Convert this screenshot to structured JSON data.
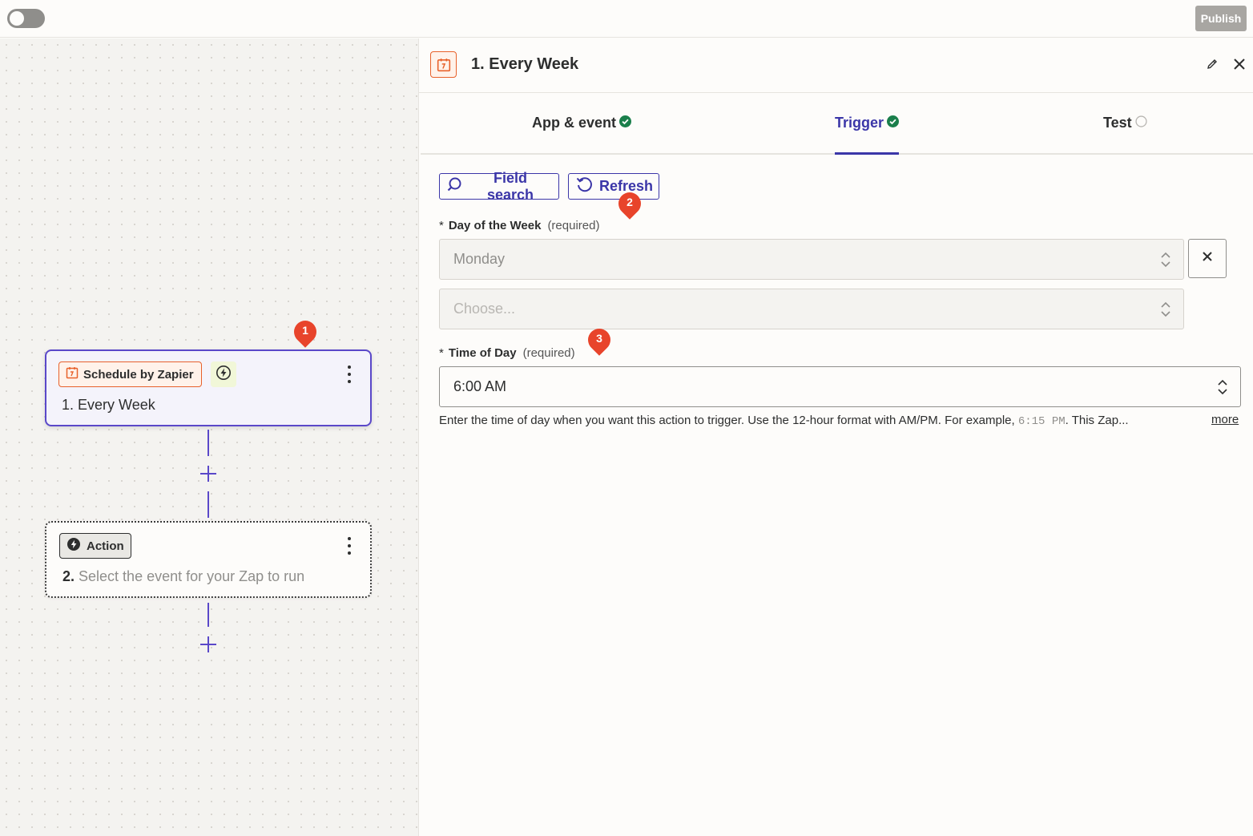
{
  "topbar": {
    "publish_label": "Publish"
  },
  "canvas": {
    "trigger_step": {
      "app_name": "Schedule by Zapier",
      "number": "1.",
      "title": "Every Week"
    },
    "action_step": {
      "chip_label": "Action",
      "number": "2.",
      "title": "Select the event for your Zap to run"
    },
    "markers": [
      "1",
      "2",
      "3"
    ]
  },
  "panel": {
    "title": "1. Every Week",
    "tabs": [
      {
        "label": "App & event",
        "status": "complete"
      },
      {
        "label": "Trigger",
        "status": "complete"
      },
      {
        "label": "Test",
        "status": "incomplete"
      }
    ],
    "field_search_label": "Field search",
    "refresh_label": "Refresh",
    "day_field": {
      "star": "*",
      "label": "Day of the Week",
      "required": "(required)",
      "value": "Monday",
      "second_placeholder": "Choose..."
    },
    "time_field": {
      "star": "*",
      "label": "Time of Day",
      "required": "(required)",
      "value": "6:00 AM"
    },
    "help": {
      "text_before": "Enter the time of day when you want this action to trigger. Use the 12-hour format with AM/PM. For example, ",
      "example": "6:15 PM",
      "text_after": ". This Zap...",
      "more_label": "more"
    }
  },
  "colors": {
    "accent": "#3b36a8",
    "brand_orange": "#e8612b",
    "success": "#1a7f4b",
    "marker": "#e8442b",
    "focus_border": "#5a48c9"
  }
}
